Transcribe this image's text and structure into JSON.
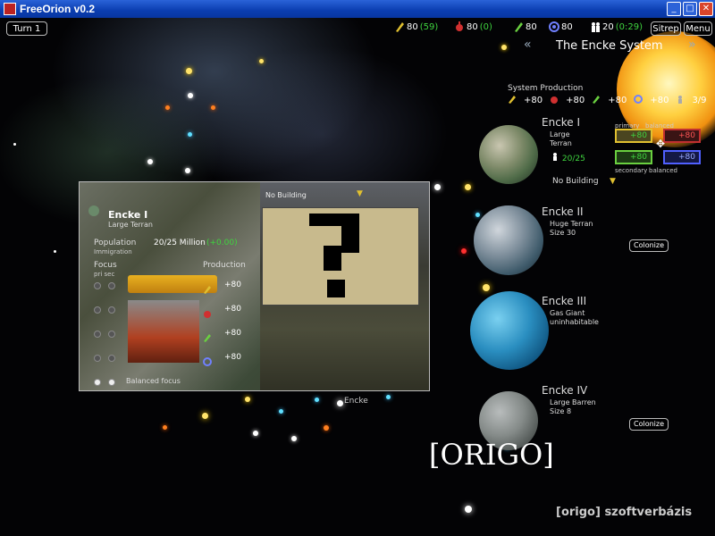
{
  "window": {
    "title": "FreeOrion v0.2"
  },
  "topbar": {
    "turn_label": "Turn 1",
    "resources": [
      {
        "icon": "industry-icon",
        "value": "80",
        "delta": "(59)",
        "delta_color": "#3fd43f"
      },
      {
        "icon": "food-icon",
        "value": "80",
        "delta": "(0)",
        "delta_color": "#3fd43f"
      },
      {
        "icon": "mining-icon",
        "value": "80",
        "delta": "",
        "delta_color": ""
      },
      {
        "icon": "research-icon",
        "value": "80",
        "delta": "",
        "delta_color": ""
      },
      {
        "icon": "population-icon",
        "value": "20",
        "delta": "(0:29)",
        "delta_color": "#3fd43f"
      }
    ],
    "sitrep_label": "Sitrep",
    "menu_label": "Menu"
  },
  "system": {
    "prev_glyph": "«",
    "next_glyph": "»",
    "name": "The Encke System",
    "production_label": "System Production",
    "production": [
      "+80",
      "+80",
      "+80",
      "+80"
    ],
    "pop_value": "3/9"
  },
  "planets": [
    {
      "name": "Encke I",
      "desc1": "Large",
      "desc2": "Terran",
      "pop": "20/25",
      "building": "No Building",
      "primary_label": "primary",
      "balanced_label": "balanced",
      "secondary_label": "secondary",
      "balanced2_label": "balanced",
      "focus": [
        "+80",
        "+80",
        "+80",
        "+80"
      ]
    },
    {
      "name": "Encke II",
      "desc1": "Huge Terran",
      "desc2": "Size 30",
      "action": "Colonize"
    },
    {
      "name": "Encke III",
      "desc1": "Gas Giant",
      "desc2": "uninhabitable"
    },
    {
      "name": "Encke IV",
      "desc1": "Large Barren",
      "desc2": "Size 8",
      "action": "Colonize"
    }
  ],
  "planet_panel": {
    "name": "Encke I",
    "type": "Large Terran",
    "population_label": "Population",
    "population_value": "20/25 Million",
    "population_delta": "(+0.00)",
    "immigration_label": "Immigration",
    "focus_label": "Focus",
    "focus_sub": "pri sec",
    "production_label": "Production",
    "values": [
      "+80",
      "+80",
      "+80",
      "+80"
    ],
    "balanced_label": "Balanced focus",
    "building_label": "No Building"
  },
  "map": {
    "system_label": "Encke"
  },
  "overlay": {
    "logo": "[ORIGO]",
    "watermark": "[origo] szoftverbázis"
  },
  "colors": {
    "title_bar": "#0a3db0",
    "accent_green": "#3fd43f",
    "industry": "#e0c030",
    "food": "#d03030",
    "mining": "#6ad040",
    "research": "#7080ff"
  }
}
